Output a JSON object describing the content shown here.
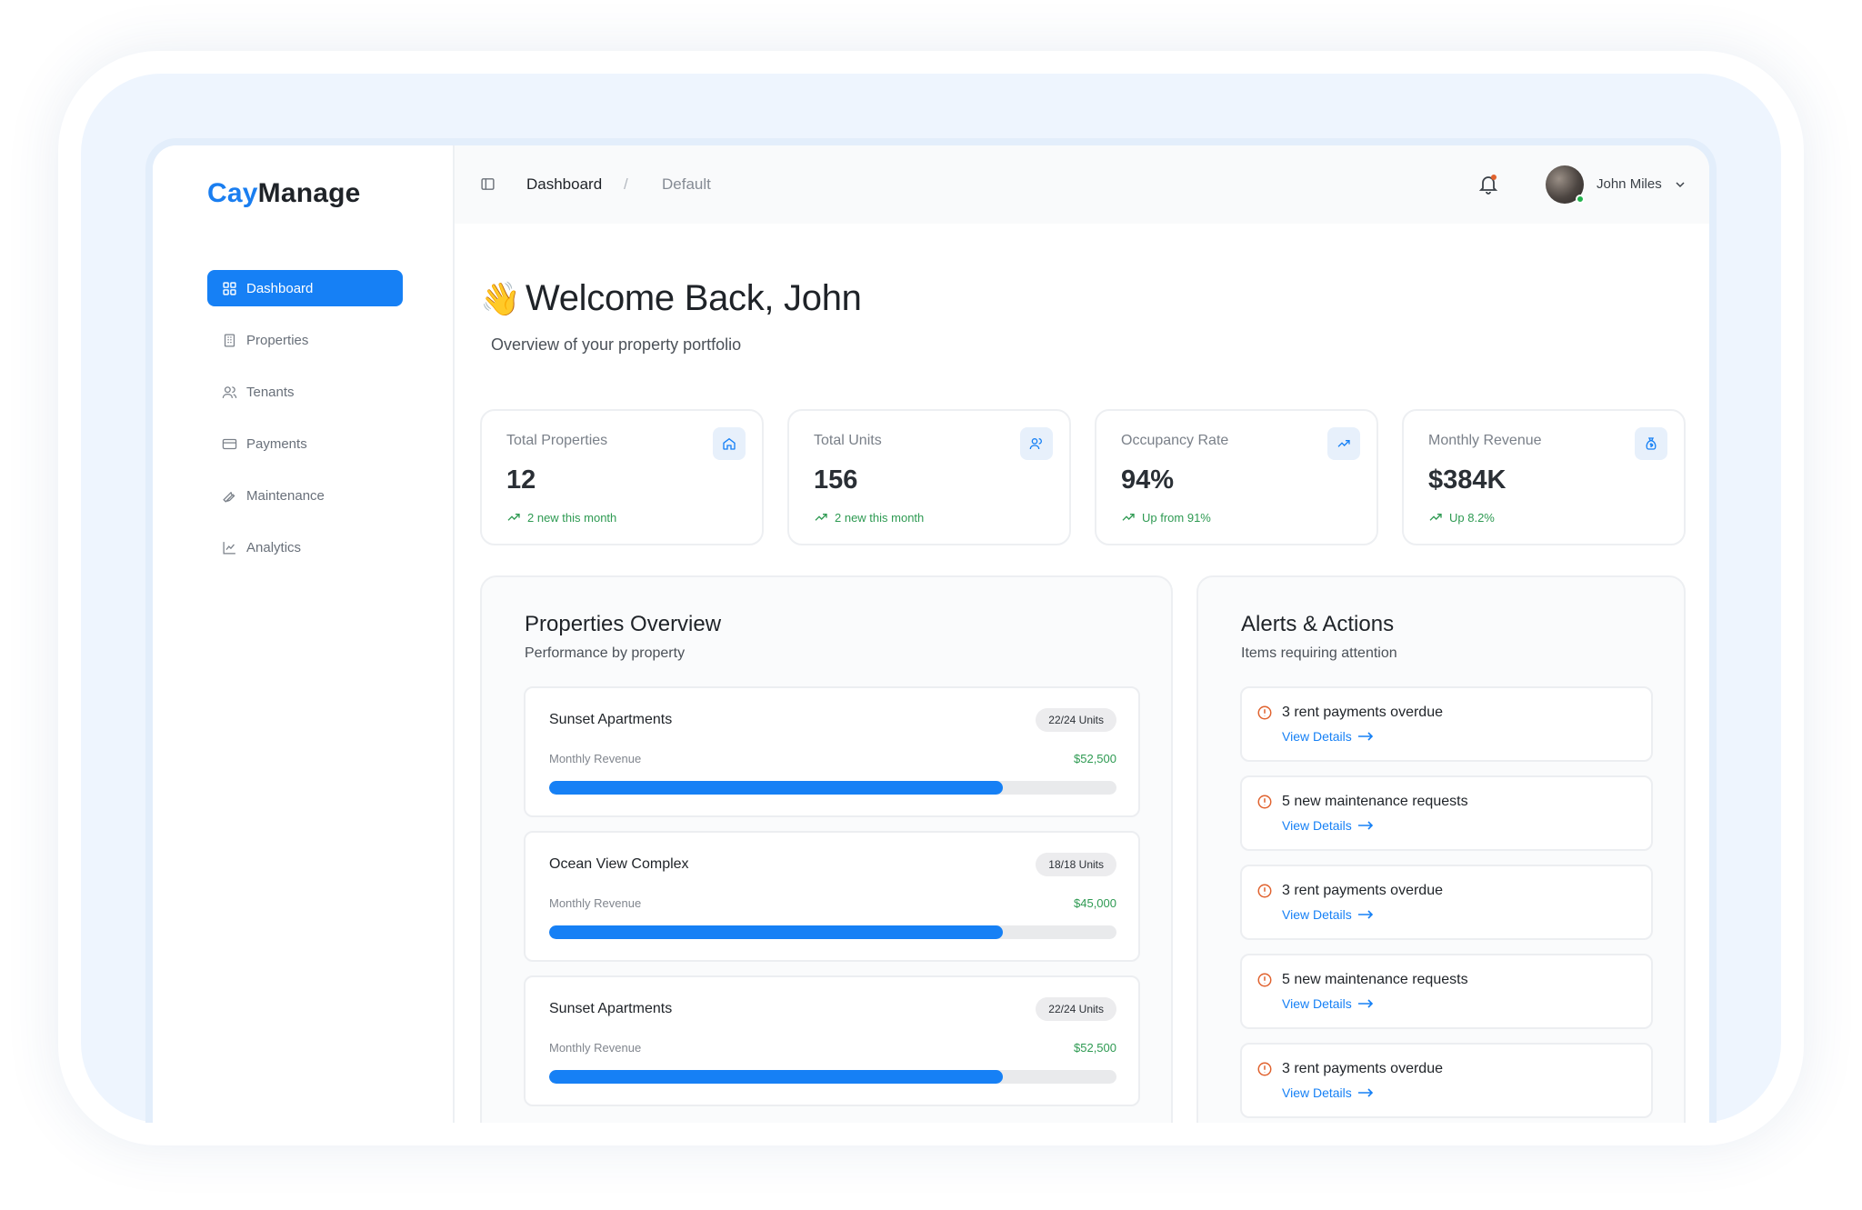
{
  "brand": {
    "part1": "Cay",
    "part2": "Manage"
  },
  "sidebar": {
    "items": [
      {
        "label": "Dashboard",
        "icon": "grid-icon",
        "active": true
      },
      {
        "label": "Properties",
        "icon": "building-icon",
        "active": false
      },
      {
        "label": "Tenants",
        "icon": "users-icon",
        "active": false
      },
      {
        "label": "Payments",
        "icon": "credit-card-icon",
        "active": false
      },
      {
        "label": "Maintenance",
        "icon": "wrench-icon",
        "active": false
      },
      {
        "label": "Analytics",
        "icon": "line-chart-icon",
        "active": false
      }
    ]
  },
  "header": {
    "breadcrumb": {
      "current": "Dashboard",
      "separator": "/",
      "sub": "Default"
    },
    "user": {
      "name": "John Miles"
    }
  },
  "welcome": {
    "emoji": "👋",
    "title": "Welcome Back, John",
    "subtitle": "Overview of your property portfolio"
  },
  "stats": [
    {
      "label": "Total Properties",
      "value": "12",
      "change": "2 new this month",
      "icon": "home-icon"
    },
    {
      "label": "Total Units",
      "value": "156",
      "change": "2 new this month",
      "icon": "users-icon"
    },
    {
      "label": "Occupancy Rate",
      "value": "94%",
      "change": "Up from 91%",
      "icon": "trending-up-icon"
    },
    {
      "label": "Monthly Revenue",
      "value": "$384K",
      "change": "Up 8.2%",
      "icon": "money-bag-icon"
    }
  ],
  "properties_panel": {
    "title": "Properties Overview",
    "subtitle": "Performance by property",
    "items": [
      {
        "name": "Sunset Apartments",
        "units": "22/24 Units",
        "revenue_label": "Monthly Revenue",
        "revenue": "$52,500",
        "progress": 0.8
      },
      {
        "name": "Ocean View Complex",
        "units": "18/18 Units",
        "revenue_label": "Monthly Revenue",
        "revenue": "$45,000",
        "progress": 0.8
      },
      {
        "name": "Sunset Apartments",
        "units": "22/24 Units",
        "revenue_label": "Monthly Revenue",
        "revenue": "$52,500",
        "progress": 0.8
      }
    ]
  },
  "alerts_panel": {
    "title": "Alerts & Actions",
    "subtitle": "Items requiring attention",
    "accent": "#e0622e",
    "items": [
      {
        "text": "3 rent payments overdue",
        "link": "View Details"
      },
      {
        "text": "5 new maintenance requests",
        "link": "View Details"
      },
      {
        "text": "3 rent payments overdue",
        "link": "View Details"
      },
      {
        "text": "5 new maintenance requests",
        "link": "View Details"
      },
      {
        "text": "3 rent payments overdue",
        "link": "View Details"
      }
    ]
  },
  "colors": {
    "primary": "#1680f5",
    "positive": "#2e9a52",
    "alert": "#e0622e"
  }
}
